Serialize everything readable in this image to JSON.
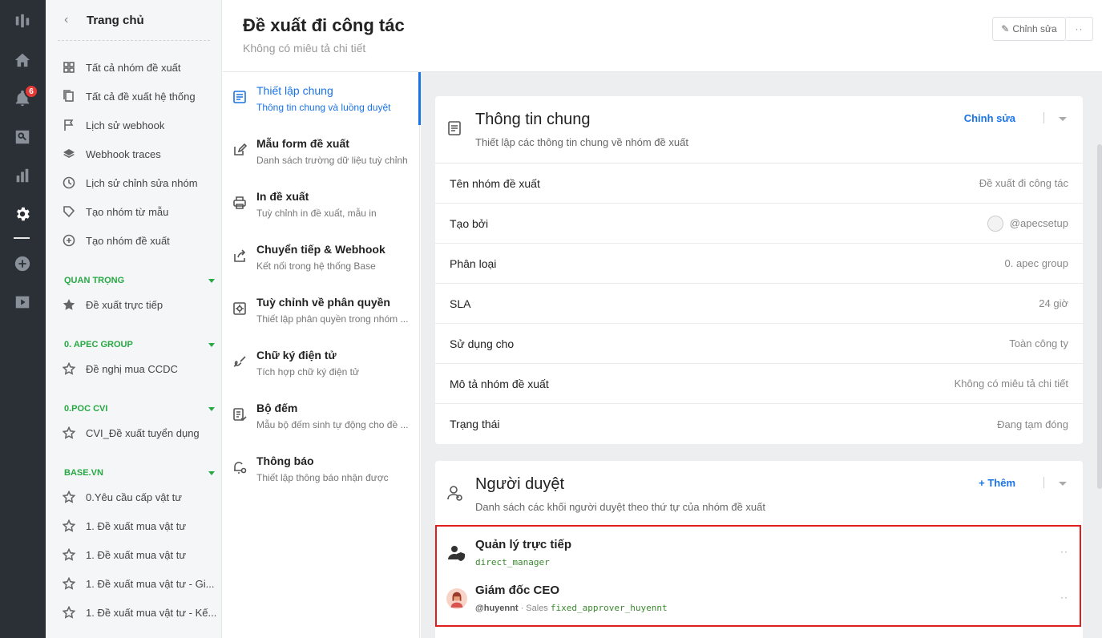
{
  "rail": {
    "notification_count": "6",
    "icons": [
      "logo-icon",
      "home-icon",
      "bell-icon",
      "search-box-icon",
      "chart-icon",
      "settings-icon",
      "plus-circle-icon",
      "video-icon"
    ]
  },
  "sidebar": {
    "back_title": "Trang chủ",
    "items": [
      {
        "label": "Tất cả nhóm đề xuất",
        "icon": "grid-icon"
      },
      {
        "label": "Tất cả đề xuất hệ thống",
        "icon": "copy-icon"
      },
      {
        "label": "Lịch sử webhook",
        "icon": "flag-icon"
      },
      {
        "label": "Webhook traces",
        "icon": "layers-icon"
      },
      {
        "label": "Lịch sử chỉnh sửa nhóm",
        "icon": "clock-icon"
      },
      {
        "label": "Tạo nhóm từ mẫu",
        "icon": "tag-icon"
      },
      {
        "label": "Tạo nhóm đề xuất",
        "icon": "plus-circle-icon"
      }
    ],
    "sections": [
      {
        "title": "QUAN TRỌNG",
        "items": [
          {
            "label": "Đề xuất trực tiếp",
            "icon": "star-filled-icon"
          }
        ]
      },
      {
        "title": "0. APEC GROUP",
        "items": [
          {
            "label": "Đề nghị mua CCDC",
            "icon": "star-icon"
          }
        ]
      },
      {
        "title": "0.POC CVI",
        "items": [
          {
            "label": "CVI_Đề xuất tuyển dụng",
            "icon": "star-icon"
          }
        ]
      },
      {
        "title": "BASE.VN",
        "items": [
          {
            "label": "0.Yêu cầu cấp vật tư",
            "icon": "star-icon"
          },
          {
            "label": "1. Đề xuất mua vật tư",
            "icon": "star-icon"
          },
          {
            "label": "1. Đề xuất mua vật tư",
            "icon": "star-icon"
          },
          {
            "label": "1. Đề xuất mua vật tư - Gi...",
            "icon": "star-icon"
          },
          {
            "label": "1. Đề xuất mua vật tư - Kế...",
            "icon": "star-icon"
          }
        ]
      }
    ]
  },
  "header": {
    "title": "Đề xuất đi công tác",
    "subtitle": "Không có miêu tả chi tiết",
    "edit_label": "Chỉnh sửa",
    "more_label": "··"
  },
  "menu": [
    {
      "title": "Thiết lập chung",
      "sub": "Thông tin chung và luồng duyệt",
      "icon": "document-icon",
      "active": true
    },
    {
      "title": "Mẫu form đề xuất",
      "sub": "Danh sách trường dữ liệu tuỳ chỉnh",
      "icon": "edit-icon"
    },
    {
      "title": "In đề xuất",
      "sub": "Tuỳ chỉnh in đề xuất, mẫu in",
      "icon": "printer-icon"
    },
    {
      "title": "Chuyển tiếp & Webhook",
      "sub": "Kết nối trong hệ thống Base",
      "icon": "share-icon"
    },
    {
      "title": "Tuỳ chỉnh về phân quyền",
      "sub": "Thiết lập phân quyền trong nhóm ...",
      "icon": "permission-icon"
    },
    {
      "title": "Chữ ký điện tử",
      "sub": "Tích hợp chữ ký điện tử",
      "icon": "signature-icon"
    },
    {
      "title": "Bộ đếm",
      "sub": "Mẫu bộ đếm sinh tự động cho đề ...",
      "icon": "counter-icon"
    },
    {
      "title": "Thông báo",
      "sub": "Thiết lập thông báo nhận được",
      "icon": "bell-gear-icon"
    }
  ],
  "general_info": {
    "title": "Thông tin chung",
    "subtitle": "Thiết lập các thông tin chung về nhóm đề xuất",
    "action": "Chỉnh sửa",
    "rows": [
      {
        "key": "Tên nhóm đề xuất",
        "value": "Đề xuất đi công tác"
      },
      {
        "key": "Tạo bởi",
        "value": "@apecsetup"
      },
      {
        "key": "Phân loại",
        "value": "0. apec group"
      },
      {
        "key": "SLA",
        "value": "24 giờ"
      },
      {
        "key": "Sử dụng cho",
        "value": "Toàn công ty"
      },
      {
        "key": "Mô tả nhóm đề xuất",
        "value": "Không có miêu tả chi tiết"
      },
      {
        "key": "Trạng thái",
        "value": "Đang tạm đóng"
      }
    ]
  },
  "approvers": {
    "title": "Người duyệt",
    "subtitle": "Danh sách các khối người duyệt theo thứ tự của nhóm đề xuất",
    "action": "+ Thêm",
    "list": [
      {
        "name": "Quản lý trực tiếp",
        "code": "direct_manager",
        "handle": "",
        "dept": ""
      },
      {
        "name": "Giám đốc CEO",
        "handle": "@huyennt",
        "dept": " · Sales ",
        "code": "fixed_approver_huyennt"
      }
    ]
  }
}
